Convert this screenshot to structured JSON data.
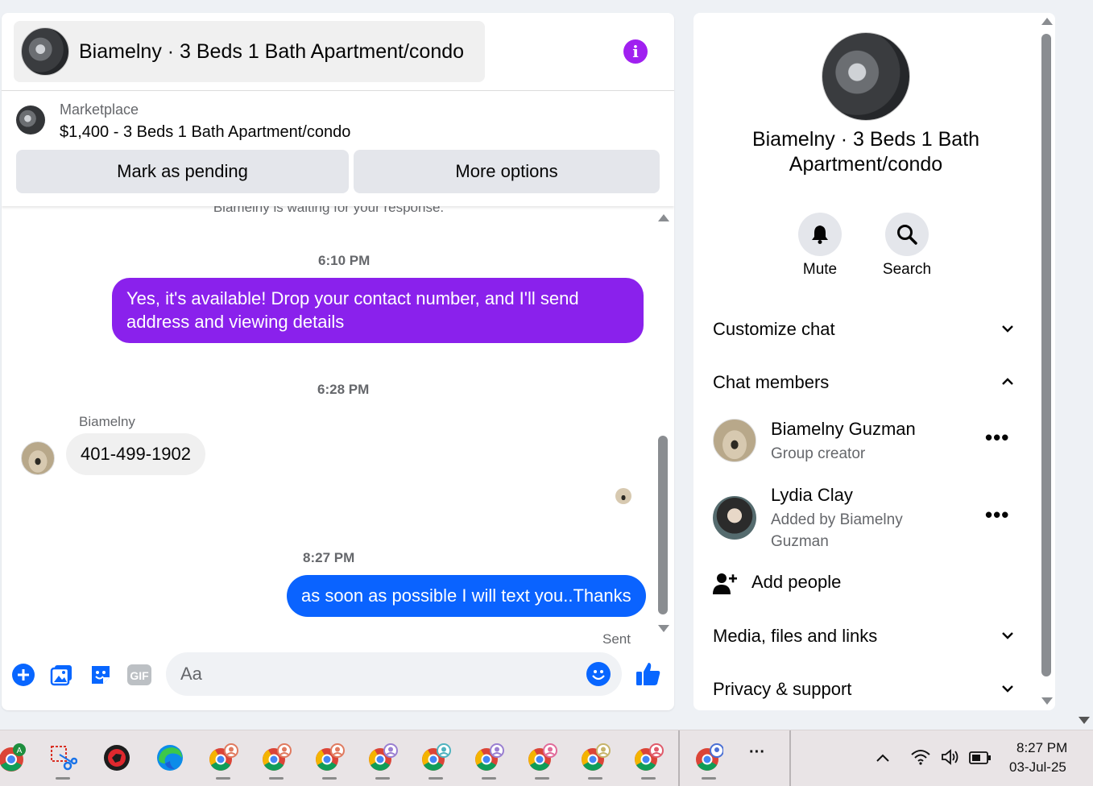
{
  "chat": {
    "title": "Biamelny · 3 Beds 1 Bath Apartment/condo",
    "listing_label": "Marketplace",
    "listing_price": "$1,400 - 3 Beds 1 Bath Apartment/condo",
    "mark_pending_label": "Mark as pending",
    "more_options_label": "More options",
    "partial_status": "Biamelny is waiting for your response.",
    "messages": [
      {
        "timestamp": "6:10 PM",
        "text": "Yes, it's available! Drop your contact number, and I'll send address and viewing details"
      },
      {
        "timestamp": "6:28 PM",
        "sender": "Biamelny",
        "text": "401-499-1902"
      },
      {
        "timestamp": "8:27 PM",
        "text": "as soon as possible I will text you..Thanks",
        "status": "Sent"
      }
    ],
    "composer_placeholder": "Aa",
    "gif_label": "GIF"
  },
  "info": {
    "title": "Biamelny · 3 Beds 1 Bath Apartment/condo",
    "mute_label": "Mute",
    "search_label": "Search",
    "customize_label": "Customize chat",
    "members_label": "Chat members",
    "members": [
      {
        "name": "Biamelny Guzman",
        "sub": "Group creator"
      },
      {
        "name": "Lydia Clay",
        "sub": "Added by Biamelny Guzman"
      }
    ],
    "add_people_label": "Add people",
    "media_label": "Media, files and links",
    "privacy_label": "Privacy & support"
  },
  "taskbar": {
    "time": "8:27 PM",
    "date": "03-Jul-25",
    "more_label": "···"
  },
  "colors": {
    "accent_purple": "#8a21ec",
    "accent_blue": "#0a63ff",
    "info_button": "#a020f0",
    "icon_blue": "#0866ff"
  }
}
